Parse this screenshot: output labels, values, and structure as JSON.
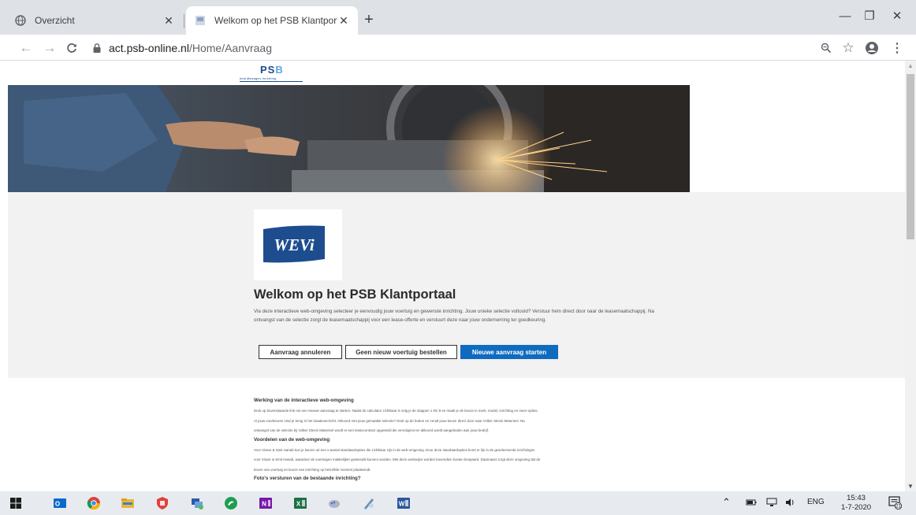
{
  "browser": {
    "tabs": [
      {
        "title": "Overzicht",
        "active": false
      },
      {
        "title": "Welkom op het PSB Klantportaal",
        "active": true
      }
    ],
    "new_tab_label": "+",
    "window_controls": {
      "minimize": "—",
      "maximize": "❐",
      "close": "✕"
    },
    "nav": {
      "back": "←",
      "forward": "→",
      "reload": "C"
    },
    "url": {
      "host": "act.psb-online.nl",
      "path": "/Home/Aanvraag"
    },
    "toolbar_icons": {
      "zoom": "zoom-icon",
      "star": "☆",
      "profile": "profile-icon",
      "menu": "⋮"
    }
  },
  "page": {
    "logo": {
      "word_main": "PS",
      "word_accent": "B",
      "tagline": "bedrijfswagen inrichting"
    },
    "brand_card": {
      "text": "WEVi"
    },
    "welcome": {
      "title": "Welkom op het PSB Klantportaal",
      "text": "Via deze interactieve web-omgeving selecteer je eenvoudig jouw voertuig en gewenste inrichting. Jouw unieke selectie voltooid? Verstuur hem direct door naar de leasemaatschappij. Na ontvangst van de selectie zorgt de leasemaatschappij voor een lease-offerte en verstuurt deze naar jouw onderneming ter goedkeuring."
    },
    "buttons": {
      "cancel": "Aanvraag annuleren",
      "no_new": "Geen nieuw voertuig bestellen",
      "new_request": "Nieuwe aanvraag starten"
    },
    "info": {
      "s1_title": "Werking van de interactieve web-omgeving",
      "s1_p1": "Druk op bovenstaande link om een nieuwe aanvraag te starten. Nadat de calculator zichtbaar is volg je de stappen 1 t/m 8 en maak je de keuze in merk, model, inrichting en meer-opties.",
      "s1_p2": "Al jouw voorkeuren vind je terug in het totaaloverzicht. Akkoord met jouw gemaakte selectie? Druk op de button en zendt jouw keuze direct door naar Volker Stevin Materieel. Na",
      "s1_p3": "ontvangst van de selectie bij Volker Stevin Materieel wordt er een leasecontract opgesteld die vervolgens ter akkoord wordt aangeboden aan jouw bedrijf.",
      "s2_title": "Voordelen van de web-omgeving",
      "s2_p1": "Voor Visser & Smit Hanab kun je kiezen uit een x-aantal standaardopties die zichtbaar zijn in de web-omgeving. Door deze standaardopties komt er lijn in de geselecteerde inrichtingen",
      "s2_p2": "voor Visser & Smit Hanab, waardoor de voertuigen makkelijker gewisseld kunnen worden. Met deze werkwijze worden bovendien kosten bespaard. Daarnaast zorgt deze omgeving dat de",
      "s2_p3": "keuze van voertuig en keuze van inrichting op hetzelfde moment plaatsvindt.",
      "s3_title": "Foto's versturen van de bestaande inrichting?"
    }
  },
  "taskbar": {
    "apps": [
      "windows-start-icon",
      "outlook-icon",
      "chrome-icon",
      "file-explorer-icon",
      "security-app-icon",
      "network-app-icon",
      "edge-like-app-icon",
      "onenote-icon",
      "excel-icon",
      "paint-icon",
      "draw-icon",
      "word-icon"
    ],
    "tray": {
      "chevron": "⌃",
      "language": "ENG",
      "volume": "🔊"
    },
    "clock": {
      "time": "15:43",
      "date": "1-7-2020"
    },
    "notifications": "21"
  },
  "colors": {
    "primary_button": "#0f6bbf",
    "psb_blue": "#1a4c8b",
    "wevi_blue": "#1d4d8e"
  }
}
